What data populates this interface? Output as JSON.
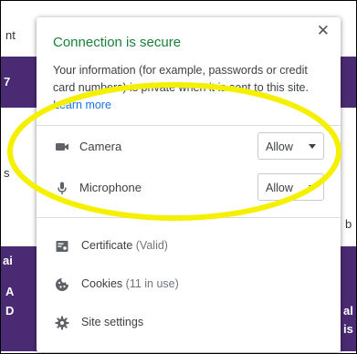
{
  "background": {
    "fragments": [
      "nt",
      "7",
      "s",
      "ai",
      "A",
      "D",
      "al",
      "is",
      "b"
    ]
  },
  "popup": {
    "title": "Connection is secure",
    "description": "Your information (for example, passwords or credit card numbers) is private when it is sent to this site.",
    "learn_more": "Learn more",
    "permissions": [
      {
        "icon": "camera-icon",
        "label": "Camera",
        "value": "Allow"
      },
      {
        "icon": "microphone-icon",
        "label": "Microphone",
        "value": "Allow"
      }
    ],
    "items": [
      {
        "icon": "certificate-icon",
        "label": "Certificate",
        "sub": "(Valid)"
      },
      {
        "icon": "cookie-icon",
        "label": "Cookies",
        "sub": "(11 in use)"
      },
      {
        "icon": "gear-icon",
        "label": "Site settings",
        "sub": ""
      }
    ]
  },
  "colors": {
    "secure_green": "#188038",
    "link_blue": "#1a73e8",
    "highlight_yellow": "#f5f000",
    "purple_band": "#4a2a72"
  }
}
